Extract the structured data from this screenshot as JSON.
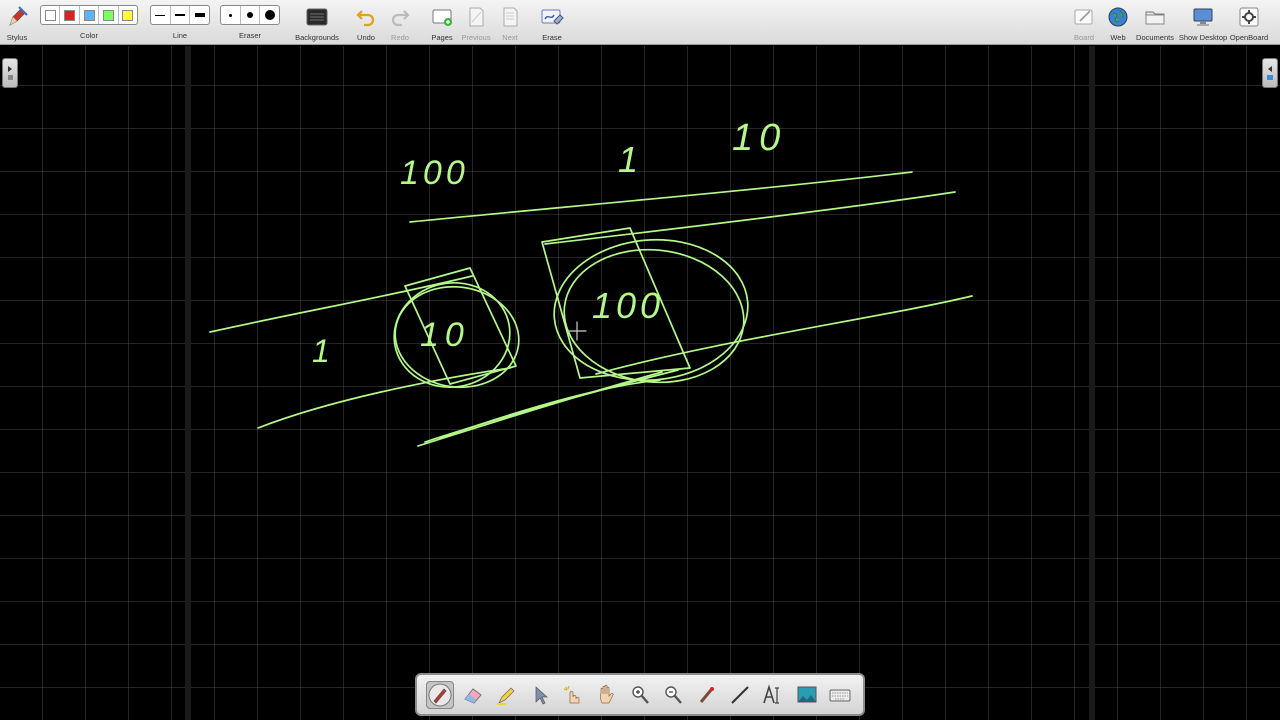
{
  "toolbar": {
    "stylus": "Stylus",
    "color": "Color",
    "line": "Line",
    "eraser": "Eraser",
    "backgrounds": "Backgrounds",
    "undo": "Undo",
    "redo": "Redo",
    "pages": "Pages",
    "previous": "Previous",
    "next": "Next",
    "erase": "Erase",
    "board": "Board",
    "web": "Web",
    "documents": "Documents",
    "show_desktop": "Show Desktop",
    "openboard": "OpenBoard"
  },
  "colors": {
    "palette": [
      "#ffffff",
      "#e02020",
      "#5ab4ff",
      "#7dff60",
      "#ffff30"
    ],
    "ink": "#b5f88a",
    "grid": "#4a4a4a",
    "board_background": "#000000"
  },
  "handwriting": {
    "label_100_top": "100",
    "label_1_top": "1",
    "label_10_top": "10",
    "label_1_left": "1",
    "label_10_circle": "10",
    "label_100_circle": "100"
  },
  "dock": {
    "tools": [
      "pen-tool",
      "eraser-tool",
      "highlighter-tool",
      "selector-tool",
      "interactor-tool",
      "hand-tool",
      "zoom-in-tool",
      "zoom-out-tool",
      "laser-pointer-tool",
      "line-tool",
      "text-tool",
      "capture-tool",
      "keyboard-tool"
    ],
    "active": "pen-tool"
  }
}
